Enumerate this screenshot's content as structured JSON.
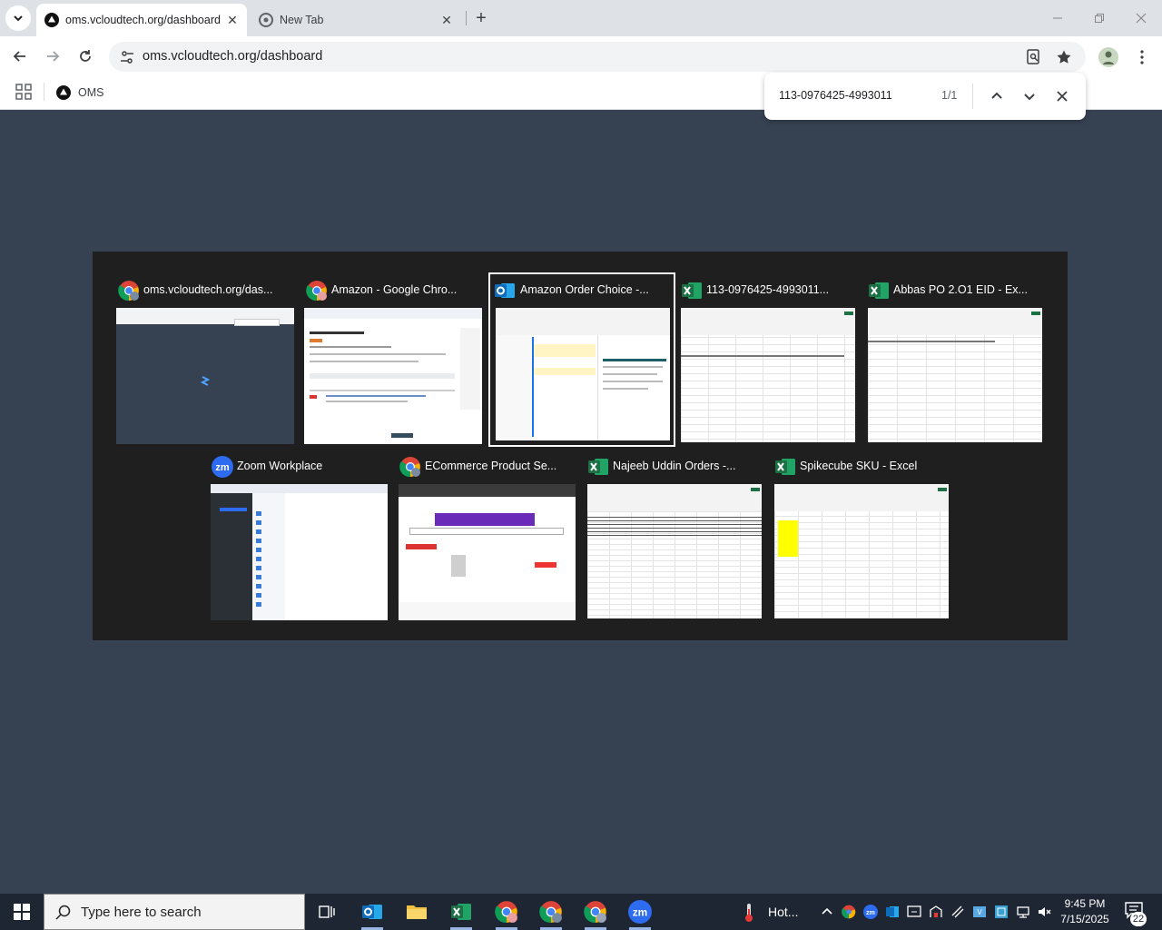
{
  "browser": {
    "tabs": [
      {
        "label": "oms.vcloudtech.org/dashboard",
        "active": true
      },
      {
        "label": "New Tab",
        "active": false
      }
    ],
    "url": "oms.vcloudtech.org/dashboard",
    "bookmarks": [
      {
        "label": "OMS"
      }
    ],
    "find": {
      "query": "113-0976425-4993011",
      "count": "1/1"
    }
  },
  "switcher": {
    "windows": [
      {
        "title": "oms.vcloudtech.org/das...",
        "app": "chrome"
      },
      {
        "title": "Amazon - Google Chro...",
        "app": "chrome"
      },
      {
        "title": "Amazon Order Choice -...",
        "app": "outlook",
        "selected": true
      },
      {
        "title": "113-0976425-4993011...",
        "app": "excel"
      },
      {
        "title": "Abbas PO 2.O1  EID - Ex...",
        "app": "excel"
      },
      {
        "title": "Zoom Workplace",
        "app": "zoom"
      },
      {
        "title": "ECommerce Product Se...",
        "app": "chrome"
      },
      {
        "title": "Najeeb Uddin Orders -...",
        "app": "excel"
      },
      {
        "title": "Spikecube SKU - Excel",
        "app": "excel"
      }
    ]
  },
  "taskbar": {
    "search_placeholder": "Type here to search",
    "weather": "Hot...",
    "time": "9:45 PM",
    "date": "7/15/2025",
    "notifications": "22"
  },
  "colors": {
    "desktop": "#364152",
    "switcher_bg": "#1f1f1f",
    "excel": "#1d7044",
    "outlook": "#0f6cbd",
    "zoom": "#2d6bf0"
  }
}
